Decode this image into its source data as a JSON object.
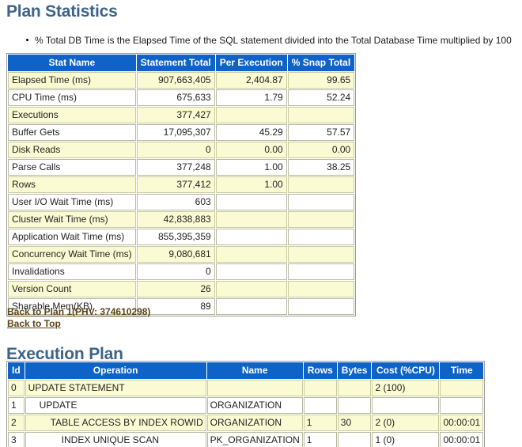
{
  "page": {
    "plan_statistics_title": "Plan Statistics",
    "execution_plan_title": "Execution Plan",
    "note": "% Total DB Time is the Elapsed Time of the SQL statement divided into the Total Database Time multiplied by 100"
  },
  "stats_table": {
    "headers": [
      "Stat Name",
      "Statement Total",
      "Per Execution",
      "% Snap Total"
    ],
    "rows": [
      {
        "name": "Elapsed Time (ms)",
        "total": "907,663,405",
        "per": "2,404.87",
        "snap": "99.65"
      },
      {
        "name": "CPU Time (ms)",
        "total": "675,633",
        "per": "1.79",
        "snap": "52.24"
      },
      {
        "name": "Executions",
        "total": "377,427",
        "per": "",
        "snap": ""
      },
      {
        "name": "Buffer Gets",
        "total": "17,095,307",
        "per": "45.29",
        "snap": "57.57"
      },
      {
        "name": "Disk Reads",
        "total": "0",
        "per": "0.00",
        "snap": "0.00"
      },
      {
        "name": "Parse Calls",
        "total": "377,248",
        "per": "1.00",
        "snap": "38.25"
      },
      {
        "name": "Rows",
        "total": "377,412",
        "per": "1.00",
        "snap": ""
      },
      {
        "name": "User I/O Wait Time (ms)",
        "total": "603",
        "per": "",
        "snap": ""
      },
      {
        "name": "Cluster Wait Time (ms)",
        "total": "42,838,883",
        "per": "",
        "snap": ""
      },
      {
        "name": "Application Wait Time (ms)",
        "total": "855,395,359",
        "per": "",
        "snap": ""
      },
      {
        "name": "Concurrency Wait Time (ms)",
        "total": "9,080,681",
        "per": "",
        "snap": ""
      },
      {
        "name": "Invalidations",
        "total": "0",
        "per": "",
        "snap": ""
      },
      {
        "name": "Version Count",
        "total": "26",
        "per": "",
        "snap": ""
      },
      {
        "name": "Sharable Mem(KB)",
        "total": "89",
        "per": "",
        "snap": ""
      }
    ]
  },
  "links": [
    {
      "label": "Back to Plan 1(PHV: 374610298)",
      "name": "back-to-plan-link"
    },
    {
      "label": "Back to Top",
      "name": "back-to-top-link"
    }
  ],
  "plan_table": {
    "headers": [
      "Id",
      "Operation",
      "Name",
      "Rows",
      "Bytes",
      "Cost (%CPU)",
      "Time"
    ],
    "rows": [
      {
        "id": "0",
        "indent": 0,
        "operation": "UPDATE STATEMENT",
        "name": "",
        "rows": "",
        "bytes": "",
        "cost": "2 (100)",
        "time": ""
      },
      {
        "id": "1",
        "indent": 1,
        "operation": "UPDATE",
        "name": "ORGANIZATION",
        "rows": "",
        "bytes": "",
        "cost": "",
        "time": ""
      },
      {
        "id": "2",
        "indent": 2,
        "operation": "TABLE ACCESS BY INDEX ROWID",
        "name": "ORGANIZATION",
        "rows": "1",
        "bytes": "30",
        "cost": "2 (0)",
        "time": "00:00:01"
      },
      {
        "id": "3",
        "indent": 3,
        "operation": "INDEX UNIQUE SCAN",
        "name": "PK_ORGANIZATION",
        "rows": "1",
        "bytes": "",
        "cost": "1 (0)",
        "time": "00:00:01"
      }
    ]
  },
  "colors": {
    "header_blue": "#0f63c8",
    "alt_row_cream": "#fbfbd3",
    "heading_slate": "#3d6386",
    "link_brown": "#5b4416"
  }
}
